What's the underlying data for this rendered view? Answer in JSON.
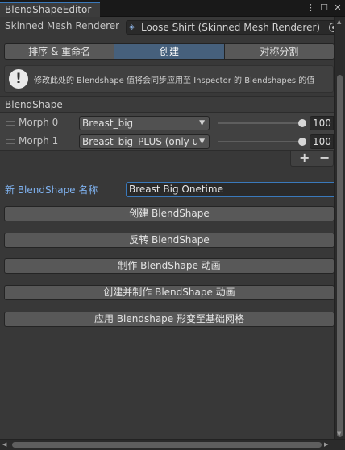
{
  "window": {
    "tab_title": "BlendShapeEditor",
    "icons": [
      "kebab-menu-icon",
      "maximize-icon",
      "close-icon"
    ]
  },
  "mesh": {
    "label": "Skinned Mesh Renderer",
    "value": "Loose Shirt (Skinned Mesh Renderer)"
  },
  "toolbar": {
    "tabs": [
      {
        "label": "排序 & 重命名",
        "active": false
      },
      {
        "label": "创建",
        "active": true
      },
      {
        "label": "对称分割",
        "active": false
      }
    ]
  },
  "help": {
    "message": "修改此处的 Blendshape 值将会同步应用至 Inspector 的 Blendshapes 的值"
  },
  "blendshape_list": {
    "header": "BlendShape",
    "rows": [
      {
        "label": "Morph 0",
        "shape": "Breast_big",
        "weight": "100"
      },
      {
        "label": "Morph 1",
        "shape": "Breast_big_PLUS (only us",
        "weight": "100"
      }
    ],
    "add_symbol": "+",
    "remove_symbol": "−"
  },
  "new_name": {
    "label": "新 BlendShape 名称",
    "value": "Breast Big Onetime"
  },
  "actions": [
    "创建 BlendShape",
    "反转 BlendShape",
    "制作 BlendShape 动画",
    "创建并制作 BlendShape 动画",
    "应用 Blendshape 形变至基础网格"
  ],
  "colors": {
    "accent_blue": "#3a79bb",
    "active_tab": "#46607c",
    "label_blue": "#7fb2f0",
    "panel_bg": "#383838"
  }
}
